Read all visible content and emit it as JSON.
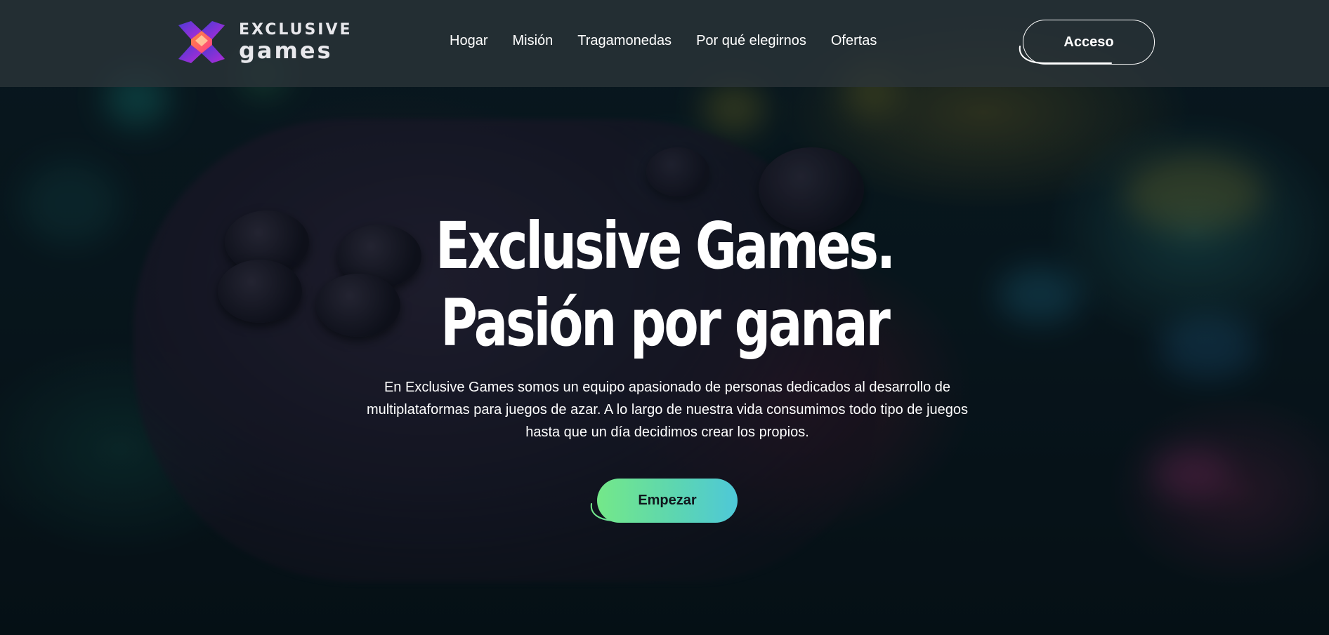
{
  "header": {
    "logo": {
      "top_text": "EXCLUSIVE",
      "bottom_text": "games",
      "icon": "cube-x-logo-icon"
    },
    "nav": [
      {
        "label": "Hogar"
      },
      {
        "label": "Misión"
      },
      {
        "label": "Tragamonedas"
      },
      {
        "label": "Por qué elegirnos"
      },
      {
        "label": "Ofertas"
      }
    ],
    "login_label": "Acceso"
  },
  "hero": {
    "title_line1": "Exclusive Games.",
    "title_line2": "Pasión por ganar",
    "description": "En Exclusive Games somos un equipo apasionado de personas dedicados al desarrollo de multiplataformas para juegos de azar. A lo largo de nuestra vida consumimos todo tipo de juegos hasta que un día decidimos crear los propios.",
    "cta_label": "Empezar"
  },
  "colors": {
    "cta_gradient_start": "#74e889",
    "cta_gradient_end": "#4ec8d8",
    "header_bg": "#2c343a",
    "text": "#ffffff"
  }
}
